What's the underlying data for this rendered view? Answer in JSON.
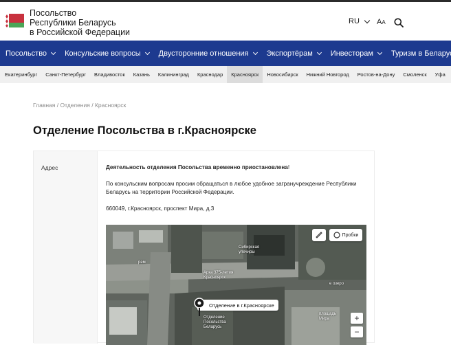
{
  "header": {
    "brand_line1": "Посольство",
    "brand_line2": "Республики Беларусь",
    "brand_line3": "в Российской Федерации",
    "lang": "RU",
    "font_size_big": "A",
    "font_size_small": "A",
    "flag_colors": {
      "red": "#c8313e",
      "green": "#4aa657",
      "ornament_bg": "#ffffff"
    }
  },
  "mainnav": {
    "color": "#1d3a8f",
    "items": [
      {
        "label": "Посольство"
      },
      {
        "label": "Консульские вопросы"
      },
      {
        "label": "Двусторонние отношения"
      },
      {
        "label": "Экспортёрам"
      },
      {
        "label": "Инвесторам"
      },
      {
        "label": "Туризм в Беларуси"
      }
    ]
  },
  "cities": [
    "Екатеринбург",
    "Санкт-Петербург",
    "Владивосток",
    "Казань",
    "Калининград",
    "Краснодар",
    "Красноярск",
    "Новосибирск",
    "Нижний Новгород",
    "Ростов-на-Дону",
    "Смоленск",
    "Уфа"
  ],
  "active_city": "Красноярск",
  "breadcrumb": {
    "home": "Главная",
    "sep": "/",
    "section": "Отделения",
    "current": "Красноярск"
  },
  "page": {
    "title": "Отделение Посольства в г.Красноярске",
    "address_label": "Адрес",
    "notice": "Деятельность отделения Посольства временно приостановлена",
    "notice_end": "!",
    "consular_text": "По консульским вопросам просим обращаться в любое удобное загранучреждение Республики Беларусь на территории Российской Федерации.",
    "address": "660049, г.Красноярск, проспект Мира, д.3"
  },
  "map": {
    "traffic_label": "Пробки",
    "pin_label": "Отделение в г.Красноярске",
    "zoom_in": "+",
    "zoom_out": "−",
    "place_siberian_line1": "Сибирская",
    "place_siberian_line2": "улечиры",
    "place_arch_line1": "Арка 375-летия",
    "place_arch_line2": "Красноярск",
    "place_office_line1": "Отделение",
    "place_office_line2": "Посольства",
    "place_office_line3": "Беларусь",
    "place_square_line1": "площадь",
    "place_square_line2": "Мира",
    "place_ozero": "е озеро",
    "place_term": "рем"
  }
}
